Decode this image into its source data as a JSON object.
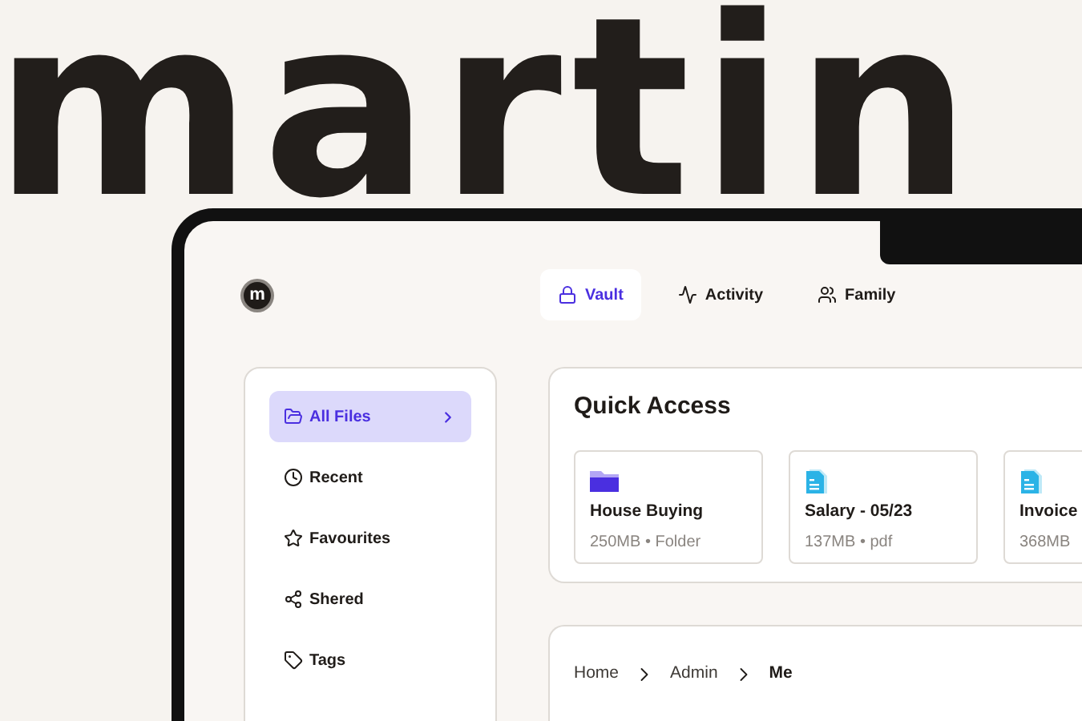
{
  "brand_word": "martin",
  "app": {
    "logo": "m",
    "tabs": [
      {
        "label": "Vault",
        "selected": true
      },
      {
        "label": "Activity",
        "selected": false
      },
      {
        "label": "Family",
        "selected": false
      }
    ],
    "sidebar": {
      "items": [
        {
          "label": "All Files",
          "selected": true
        },
        {
          "label": "Recent",
          "selected": false
        },
        {
          "label": "Favourites",
          "selected": false
        },
        {
          "label": "Shered",
          "selected": false
        },
        {
          "label": "Tags",
          "selected": false
        }
      ]
    },
    "quick_access": {
      "title": "Quick Access",
      "items": [
        {
          "kind": "folder",
          "name": "House Buying",
          "meta": "250MB • Folder"
        },
        {
          "kind": "file",
          "name": "Salary - 05/23",
          "meta": "137MB • pdf"
        },
        {
          "kind": "file",
          "name": "Invoice",
          "meta": "368MB"
        }
      ]
    },
    "breadcrumb": [
      {
        "label": "Home",
        "current": false
      },
      {
        "label": "Admin",
        "current": false
      },
      {
        "label": "Me",
        "current": true
      }
    ]
  }
}
